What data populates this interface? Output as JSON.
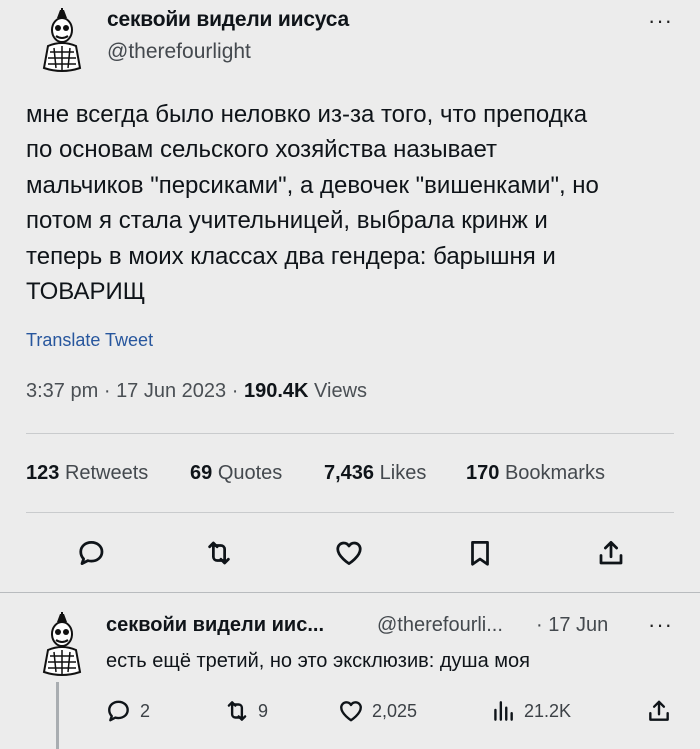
{
  "main_tweet": {
    "author_name": "секвойи видели иисуса",
    "author_handle": "@therefourlight",
    "more": "···",
    "text_lines": [
      "мне всегда было неловко из-за того, что преподка",
      "по основам сельского хозяйства называет",
      "мальчиков \"персиками\", а девочек \"вишенками\", но",
      "потом я стала учительницей, выбрала кринж и",
      "теперь в моих классах два гендера: барышня и",
      "ТОВАРИЩ"
    ],
    "translate_label": "Translate Tweet",
    "time": "3:37 pm",
    "date": "17 Jun 2023",
    "separator": "·",
    "views_count": "190.4K",
    "views_label": "Views",
    "stats": {
      "retweets_count": "123",
      "retweets_label": "Retweets",
      "quotes_count": "69",
      "quotes_label": "Quotes",
      "likes_count": "7,436",
      "likes_label": "Likes",
      "bookmarks_count": "170",
      "bookmarks_label": "Bookmarks"
    },
    "actions": [
      "reply-icon",
      "retweet-icon",
      "like-icon",
      "bookmark-icon",
      "share-icon"
    ]
  },
  "reply_tweet": {
    "author_name": "секвойи видели иис...",
    "author_handle": "@therefourli...",
    "date": "· 17 Jun",
    "more": "···",
    "text": "есть ещё третий, но это эксклюзив: душа моя",
    "reply_count": "2",
    "retweet_count": "9",
    "like_count": "2,025",
    "views_count": "21.2K"
  },
  "colors": {
    "background": "#ececec",
    "link": "#27569d",
    "text": "#0f1419",
    "secondary": "#44494e"
  }
}
